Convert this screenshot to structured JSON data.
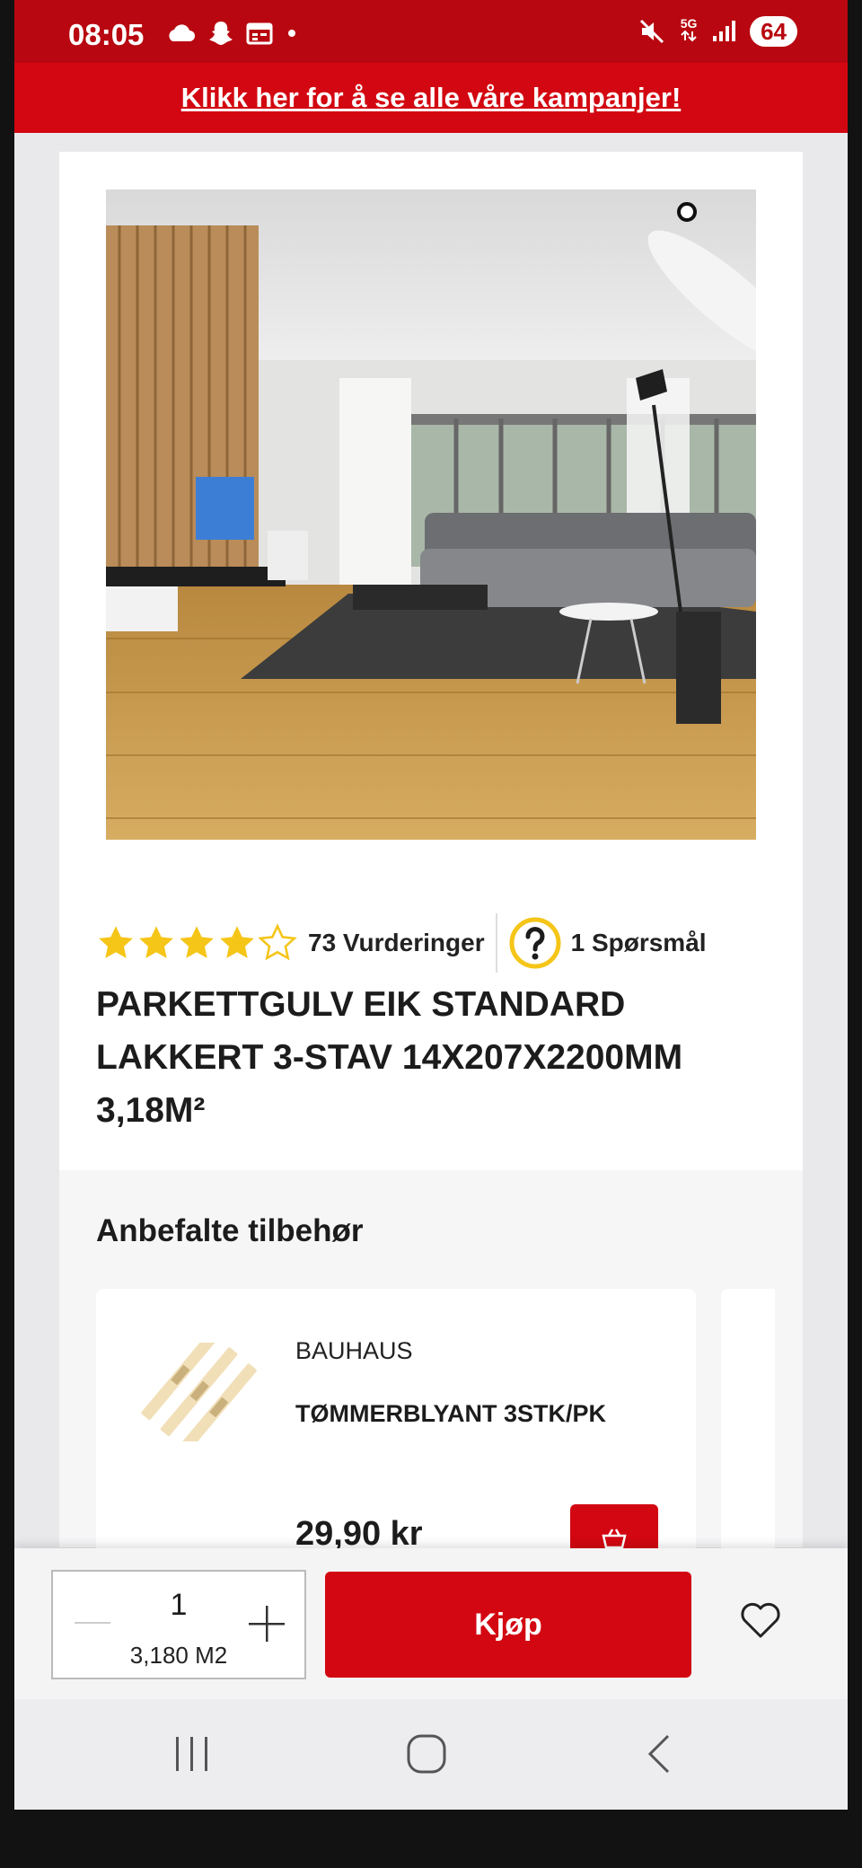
{
  "status_bar": {
    "time": "08:05",
    "network": "5G",
    "battery": "64"
  },
  "promo": {
    "text": "Klikk her for å se alle våre kampanjer!"
  },
  "product": {
    "rating_value": 4,
    "rating_max": 5,
    "rating_count": "73 Vurderinger",
    "questions": "1 Spørsmål",
    "title": "PARKETTGULV EIK STANDARD LAKKERT 3-STAV 14X207X2200MM 3,18M²"
  },
  "accessories": {
    "title": "Anbefalte tilbehør",
    "items": [
      {
        "brand": "BAUHAUS",
        "name": "TØMMERBLYANT 3STK/PK",
        "price": "29,90 kr"
      }
    ]
  },
  "buy_bar": {
    "quantity": "1",
    "unit": "3,180 M2",
    "buy_label": "Kjøp"
  },
  "colors": {
    "brand_red": "#d30711",
    "status_red": "#b80710",
    "star_yellow": "#f5c518"
  }
}
